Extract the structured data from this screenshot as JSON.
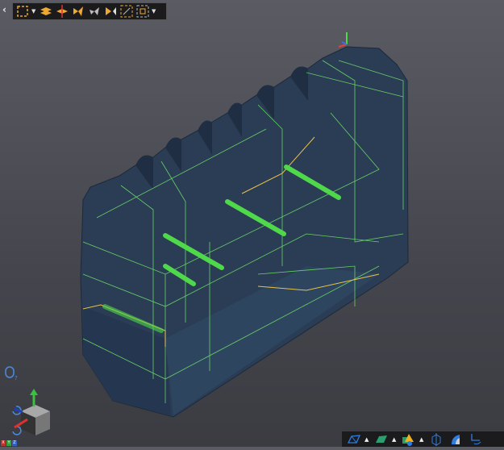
{
  "toolbar": {
    "back_icon": "chevron-left-icon",
    "buttons": [
      "select-box-icon",
      "explode-icon",
      "collapse-icon",
      "previous-step-icon",
      "play-back-icon",
      "play-forward-icon",
      "fit-all-icon",
      "fit-selection-icon"
    ]
  },
  "bottom_toolbar": {
    "buttons": [
      "wireframe-icon",
      "shaded-icon",
      "shapes-icon",
      "bounding-box-icon",
      "section-icon",
      "axis-icon"
    ]
  },
  "axes": {
    "x": "X",
    "y": "Y",
    "z": "Z"
  },
  "colors": {
    "background": "#4b4c53",
    "model": "#2a3e56",
    "edges": "#6ee06a",
    "highlight": "#e8c24a",
    "rods": "#4fd84a",
    "accent": "#f0a830"
  }
}
